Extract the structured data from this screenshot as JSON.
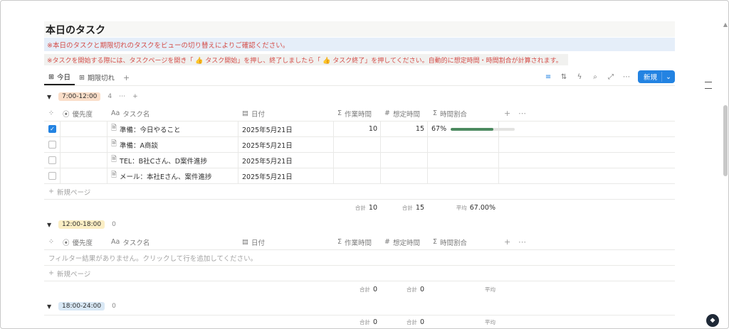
{
  "page": {
    "title": "本日のタスク",
    "note1": "※本日のタスクと期限切れのタスクをビューの切り替えによりご確認ください。",
    "note2": "※タスクを開始する際には、タスクページを開き「 👍 タスク開始」を押し、終了しましたら「 👍 タスク終了」を押してください。自動的に想定時間・時間割合が計算されます。"
  },
  "tabs": [
    {
      "label": "今日",
      "icon": "table-icon",
      "active": true
    },
    {
      "label": "期限切れ",
      "icon": "table-icon",
      "active": false
    }
  ],
  "toolbar": {
    "new_label": "新規"
  },
  "columns": {
    "priority": "優先度",
    "name": "タスク名",
    "date": "日付",
    "work": "作業時間",
    "expected": "想定時間",
    "ratio": "時間割合",
    "name_prefix": "Aa",
    "sum_symbol": "Σ",
    "num_symbol": "#"
  },
  "groups": [
    {
      "label": "7:00-12:00",
      "color": "#fadec9",
      "count": "4",
      "rows": [
        {
          "checked": true,
          "name": "準備：今日やること",
          "date": "2025年5月21日",
          "work": "10",
          "expected": "15",
          "ratio": "67%",
          "ratio_value": 0.67
        },
        {
          "checked": false,
          "name": "準備：A商談",
          "date": "2025年5月21日",
          "work": "",
          "expected": "",
          "ratio": "",
          "ratio_value": null
        },
        {
          "checked": false,
          "name": "TEL：B社Cさん、D案件進捗",
          "date": "2025年5月21日",
          "work": "",
          "expected": "",
          "ratio": "",
          "ratio_value": null
        },
        {
          "checked": false,
          "name": "メール：本社Eさん、案件進捗",
          "date": "2025年5月21日",
          "work": "",
          "expected": "",
          "ratio": "",
          "ratio_value": null
        }
      ],
      "summary": {
        "work_label": "合計",
        "work": "10",
        "expected_label": "合計",
        "expected": "15",
        "ratio_label": "平均",
        "ratio": "67.00%"
      }
    },
    {
      "label": "12:00-18:00",
      "color": "#fbeec4",
      "count": "0",
      "empty_text": "フィルター結果がありません。クリックして行を追加してください。",
      "summary": {
        "work_label": "合計",
        "work": "0",
        "expected_label": "合計",
        "expected": "0",
        "ratio_label": "平均",
        "ratio": ""
      }
    },
    {
      "label": "18:00-24:00",
      "color": "#d9e8f5",
      "count": "0",
      "summary": {
        "work_label": "合計",
        "work": "0",
        "expected_label": "合計",
        "expected": "0",
        "ratio_label": "平均",
        "ratio": ""
      }
    }
  ],
  "new_page_label": "新規ページ",
  "colors": {
    "accent": "#2383e2",
    "warning_text": "#d44c47",
    "progress": "#4c8a5f"
  }
}
